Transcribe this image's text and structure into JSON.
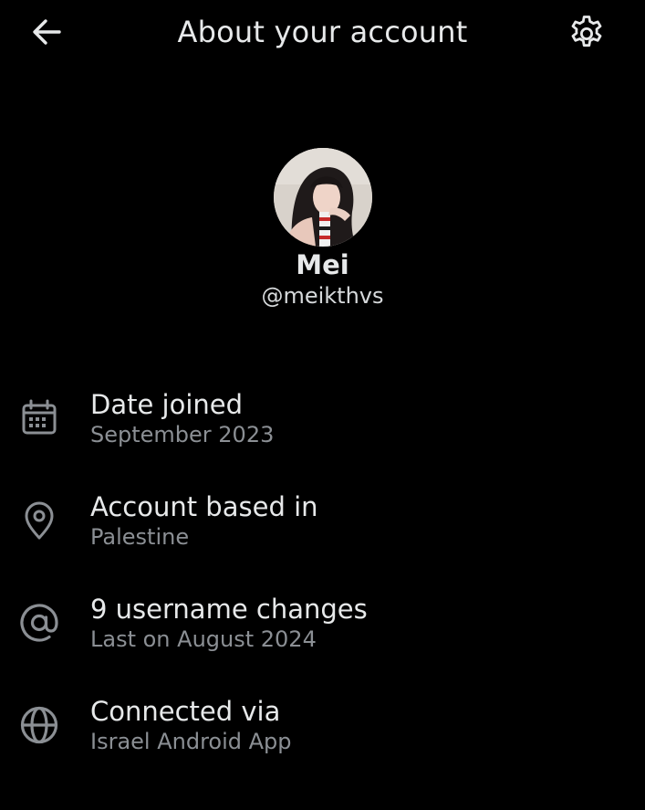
{
  "header": {
    "title": "About your account",
    "back_icon": "arrow-left-icon",
    "settings_icon": "gear-icon"
  },
  "profile": {
    "name": "Mei",
    "handle": "@meikthvs",
    "avatar_icon": "profile-photo"
  },
  "items": [
    {
      "icon": "calendar-icon",
      "title": "Date joined",
      "subtitle": "September 2023"
    },
    {
      "icon": "location-pin-icon",
      "title": "Account based in",
      "subtitle": "Palestine"
    },
    {
      "icon": "at-sign-icon",
      "title": "9 username changes",
      "subtitle": "Last on August 2024"
    },
    {
      "icon": "globe-icon",
      "title": "Connected via",
      "subtitle": "Israel Android App"
    }
  ],
  "colors": {
    "background": "#000000",
    "primary_text": "#e7e9ea",
    "secondary_text": "#8b8f94"
  }
}
